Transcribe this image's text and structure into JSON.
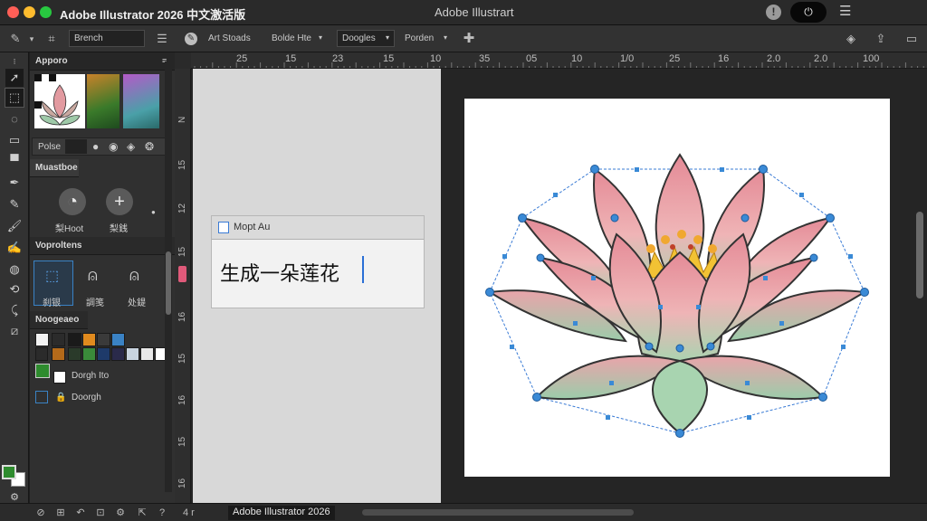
{
  "titlebar": {
    "app_title": "Adobe Illustrator 2026 中文激活版",
    "document_title": "Adobe Illustrart",
    "colors": {
      "close": "#ff5f57",
      "minimize": "#febc2e",
      "maximize": "#28c840"
    }
  },
  "controlbar": {
    "search_value": "Brench",
    "art_label": "Art Stoads",
    "dropdown_1": "Bolde Hte",
    "dropdown_2": "Doogles",
    "dropdown_3": "Porden"
  },
  "panels": {
    "appearance_title": "Apporo",
    "paths_label": "Polse",
    "mesh_title": "Muastboe",
    "mesh_left_label": "梨Hoot",
    "mesh_right_label": "梨銭",
    "operations_title": "Voproltens",
    "op_labels": [
      "刹银",
      "調笺",
      "处鍉"
    ],
    "swatches_title": "Noogeaeo",
    "swatch_colors": [
      "#f2f2f2",
      "#2b2b2b",
      "#e08a1e",
      "#3a3a3a",
      "#3a82c4",
      "#9a9a9a",
      "#1e1e1e",
      "#b46a1a",
      "#3a8a3a",
      "#1e3a6a",
      "#2a4a2a",
      "#c8d4e0",
      "#e8e8e8",
      "#ffffff"
    ],
    "layer_1": "Dorgh Ito",
    "layer_2": "Doorgh"
  },
  "ruler_top": [
    "25",
    "15",
    "23",
    "15",
    "10",
    "35",
    "05",
    "10",
    "1/0",
    "25",
    "16",
    "2.0",
    "2.0",
    "100"
  ],
  "ruler_left": [
    "N",
    "15",
    "12",
    "15",
    "16",
    "15",
    "16",
    "15",
    "16"
  ],
  "prompt": {
    "header": "Mopt Au",
    "text": "生成一朵莲花"
  },
  "statusbar": {
    "zoom": "4 r",
    "document": "Adobe Illustrator 2026"
  }
}
